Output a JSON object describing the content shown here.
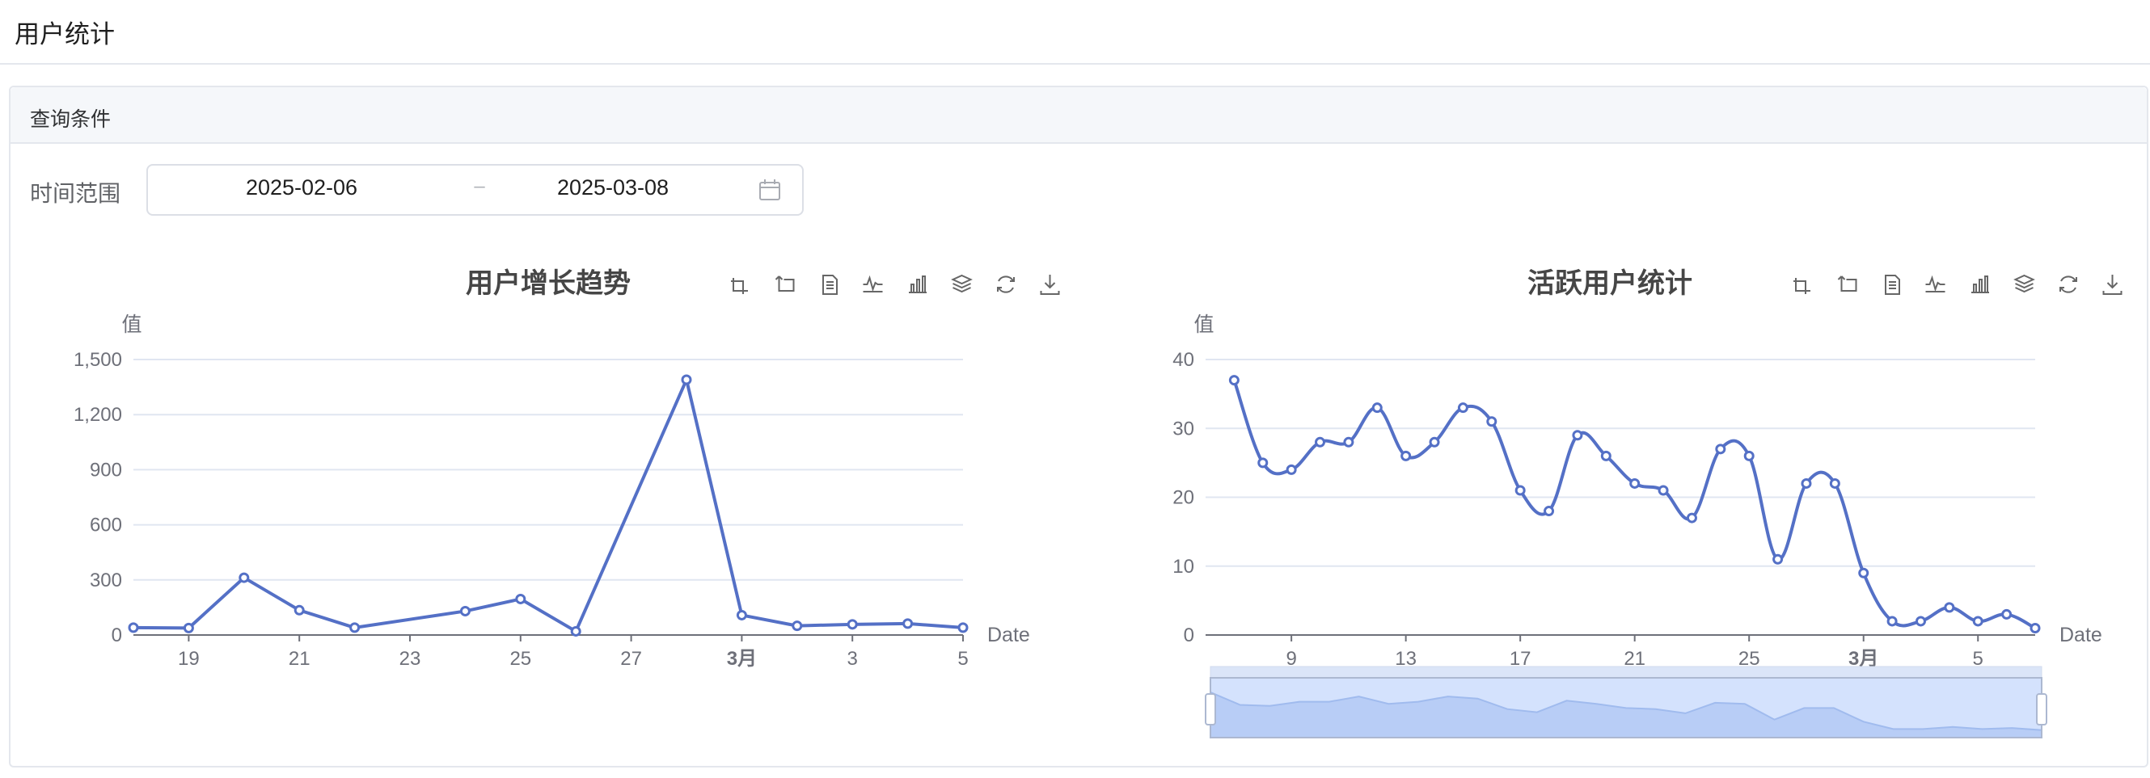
{
  "page": {
    "title": "用户统计"
  },
  "query_card": {
    "title": "查询条件",
    "time_range_label": "时间范围",
    "start_date": "2025-02-06",
    "separator": "–",
    "end_date": "2025-03-08",
    "calendar_icon": "calendar-icon"
  },
  "toolbar_icons": [
    "zoom-icon",
    "zoom-reset-icon",
    "data-view-icon",
    "line-switch-icon",
    "bar-switch-icon",
    "stack-icon",
    "restore-icon",
    "download-icon"
  ],
  "colors": {
    "series": "#5470c6",
    "grid": "#e0e6f1",
    "axis": "#6e7079",
    "datazoom_fill": "#dbe5f8",
    "datazoom_border": "#acb8d1"
  },
  "chart_data": [
    {
      "type": "line",
      "title": "用户增长趋势",
      "ylabel": "值",
      "xlabel": "Date",
      "x": [
        "2025-02-18",
        "2025-02-19",
        "2025-02-20",
        "2025-02-21",
        "2025-02-22",
        "2025-02-24",
        "2025-02-25",
        "2025-02-26",
        "2025-02-28",
        "2025-03-01",
        "2025-03-02",
        "2025-03-03",
        "2025-03-04",
        "2025-03-05"
      ],
      "values": [
        40,
        38,
        312,
        135,
        40,
        130,
        196,
        20,
        1390,
        108,
        50,
        58,
        62,
        40
      ],
      "x_ticks": [
        "19",
        "21",
        "23",
        "25",
        "27",
        "3月",
        "3",
        "5"
      ],
      "y_ticks": [
        "0",
        "300",
        "600",
        "900",
        "1,200",
        "1,500"
      ],
      "ylim": [
        0,
        1500
      ],
      "smooth": false,
      "grid": true
    },
    {
      "type": "line",
      "title": "活跃用户统计",
      "ylabel": "值",
      "xlabel": "Date",
      "x": [
        "2025-02-07",
        "2025-02-08",
        "2025-02-09",
        "2025-02-10",
        "2025-02-11",
        "2025-02-12",
        "2025-02-13",
        "2025-02-14",
        "2025-02-15",
        "2025-02-16",
        "2025-02-17",
        "2025-02-18",
        "2025-02-19",
        "2025-02-20",
        "2025-02-21",
        "2025-02-22",
        "2025-02-23",
        "2025-02-24",
        "2025-02-25",
        "2025-02-26",
        "2025-02-27",
        "2025-02-28",
        "2025-03-01",
        "2025-03-02",
        "2025-03-03",
        "2025-03-04",
        "2025-03-05",
        "2025-03-06"
      ],
      "values": [
        37,
        25,
        24,
        28,
        28,
        33,
        26,
        28,
        33,
        31,
        21,
        18,
        29,
        26,
        22,
        21,
        17,
        27,
        26,
        11,
        22,
        22,
        9,
        2,
        2,
        4,
        2,
        3,
        1
      ],
      "x_ticks": [
        "9",
        "13",
        "17",
        "21",
        "25",
        "3月",
        "5"
      ],
      "y_ticks": [
        "0",
        "10",
        "20",
        "30",
        "40"
      ],
      "ylim": [
        0,
        40
      ],
      "smooth": true,
      "grid": true,
      "data_zoom": {
        "start": 0,
        "end": 1
      }
    }
  ]
}
